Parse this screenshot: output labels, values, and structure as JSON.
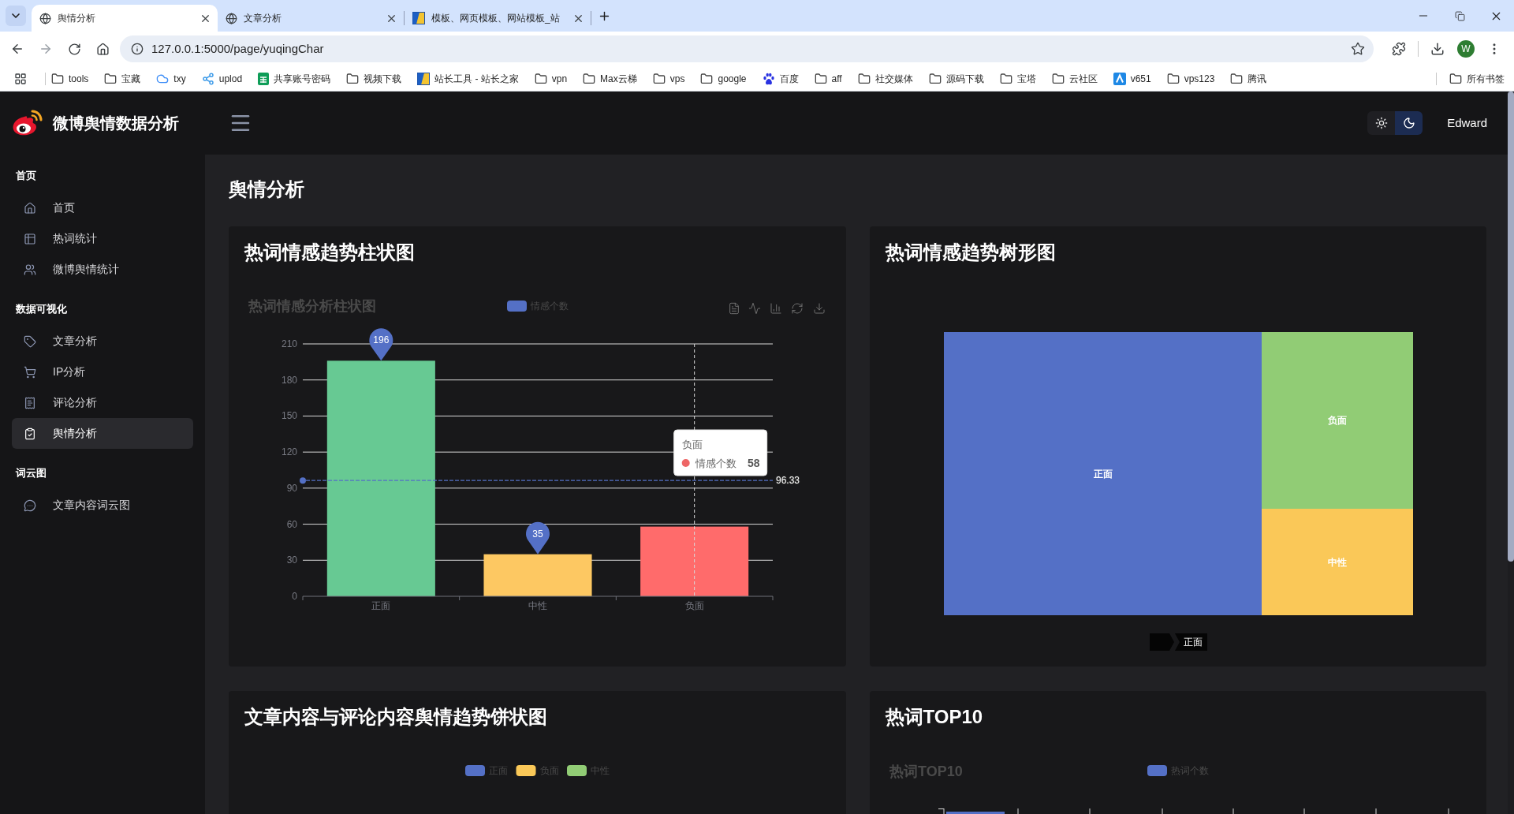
{
  "browser": {
    "tabs": [
      {
        "title": "舆情分析",
        "kind": "globe",
        "selected": true
      },
      {
        "title": "文章分析",
        "kind": "globe",
        "selected": false
      },
      {
        "title": "模板、网页模板、网站模板_站",
        "kind": "tile",
        "selected": false
      }
    ],
    "url": "127.0.0.1:5000/page/yuqingChar",
    "profile_initial": "W",
    "bookmarks": [
      {
        "label": "tools",
        "kind": "folder"
      },
      {
        "label": "宝藏",
        "kind": "folder"
      },
      {
        "label": "txy",
        "kind": "cloud"
      },
      {
        "label": "uplod",
        "kind": "share"
      },
      {
        "label": "共享账号密码",
        "kind": "sheet"
      },
      {
        "label": "视频下载",
        "kind": "folder"
      },
      {
        "label": "站长工具 - 站长之家",
        "kind": "tile"
      },
      {
        "label": "vpn",
        "kind": "folder"
      },
      {
        "label": "Max云梯",
        "kind": "folder"
      },
      {
        "label": "vps",
        "kind": "folder"
      },
      {
        "label": "google",
        "kind": "folder"
      },
      {
        "label": "百度",
        "kind": "paw"
      },
      {
        "label": "aff",
        "kind": "folder"
      },
      {
        "label": "社交媒体",
        "kind": "folder"
      },
      {
        "label": "源码下载",
        "kind": "folder"
      },
      {
        "label": "宝塔",
        "kind": "folder"
      },
      {
        "label": "云社区",
        "kind": "folder"
      },
      {
        "label": "v651",
        "kind": "badge"
      },
      {
        "label": "vps123",
        "kind": "folder"
      },
      {
        "label": "腾讯",
        "kind": "folder"
      }
    ],
    "all_bookmarks": "所有书签"
  },
  "app": {
    "title": "微博舆情数据分析",
    "theme_options": [
      {
        "selected": false
      },
      {
        "selected": true
      }
    ],
    "user": "Edward"
  },
  "sidebar": [
    {
      "label": "首页",
      "items": [
        {
          "label": "首页",
          "selected": false
        },
        {
          "label": "热词统计",
          "selected": false
        },
        {
          "label": "微博舆情统计",
          "selected": false
        }
      ]
    },
    {
      "label": "数据可视化",
      "items": [
        {
          "label": "文章分析",
          "selected": false
        },
        {
          "label": "IP分析",
          "selected": false
        },
        {
          "label": "评论分析",
          "selected": false
        },
        {
          "label": "舆情分析",
          "selected": true
        }
      ]
    },
    {
      "label": "词云图",
      "items": [
        {
          "label": "文章内容词云图",
          "selected": false
        }
      ]
    }
  ],
  "page_title": "舆情分析",
  "bar_card": {
    "title": "热词情感趋势柱状图",
    "chart_title": "热词情感分析柱状图",
    "legend": {
      "label": "情感个数",
      "color": "#5470c6"
    },
    "bars": [
      {
        "color": "#67c993"
      },
      {
        "color": "#fdc862"
      },
      {
        "color": "#ff6b6b"
      }
    ],
    "tooltip": {
      "title": "负面",
      "label": "情感个数",
      "value": "58",
      "color": "#ee6666"
    },
    "chart_data": {
      "type": "bar",
      "categories": [
        "正面",
        "中性",
        "负面"
      ],
      "series": [
        {
          "values": [
            196,
            35,
            58
          ]
        }
      ],
      "ylim": [
        0,
        210
      ],
      "yticks": [
        0,
        30,
        60,
        90,
        120,
        150,
        180,
        210
      ],
      "grid": true,
      "ref_lines": [
        {
          "axis": "y",
          "value": 96.33,
          "label": "96.33"
        },
        {
          "axis": "x",
          "value": "负面"
        }
      ],
      "annotations": [
        {
          "x": "正面",
          "y": 196,
          "text": "196"
        },
        {
          "x": "中性",
          "y": 35,
          "text": "35"
        }
      ]
    }
  },
  "treemap_card": {
    "title": "热词情感趋势树形图",
    "tiles": [
      {
        "label": "正面",
        "color": "#5470c6"
      },
      {
        "label": "负面",
        "color": "#91cc75"
      },
      {
        "label": "中性",
        "color": "#fac858"
      }
    ],
    "breadcrumb": "正面"
  },
  "pie_card": {
    "title": "文章内容与评论内容舆情趋势饼状图",
    "legend": [
      {
        "label": "正面",
        "color": "#5470c6"
      },
      {
        "label": "负面",
        "color": "#fac858"
      },
      {
        "label": "中性",
        "color": "#91cc75"
      }
    ]
  },
  "top10_card": {
    "title": "热词TOP10",
    "chart_title": "热词TOP10",
    "legend": [
      {
        "label": "热词个数",
        "color": "#5470c6"
      }
    ]
  }
}
